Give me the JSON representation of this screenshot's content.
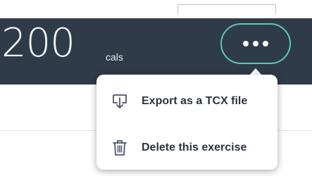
{
  "summary": {
    "calories_value": "200",
    "calories_unit": "cals"
  },
  "header": {
    "background_color": "#2f3b48",
    "accent_color": "#5ec7c0"
  },
  "menu": {
    "items": [
      {
        "label": "Export as a TCX file",
        "icon": "export-icon"
      },
      {
        "label": "Delete this exercise",
        "icon": "trash-icon"
      }
    ]
  }
}
